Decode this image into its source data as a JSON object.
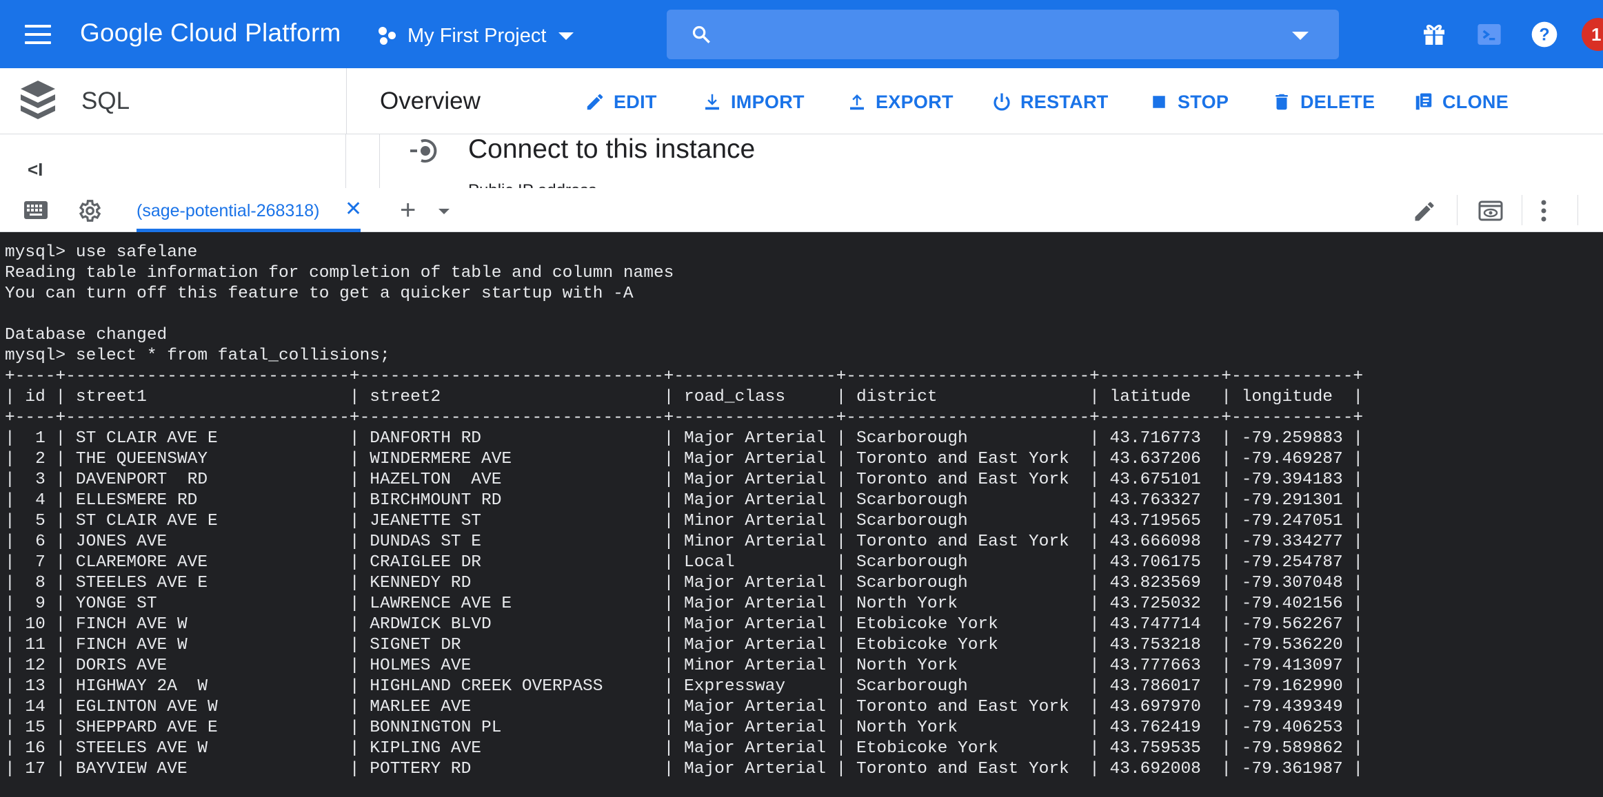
{
  "header": {
    "brand": "Google Cloud Platform",
    "project": "My First Project",
    "search_placeholder": "",
    "notification_count": "1"
  },
  "subbar": {
    "service": "SQL",
    "page_title": "Overview",
    "actions": {
      "edit": "EDIT",
      "import": "IMPORT",
      "export": "EXPORT",
      "restart": "RESTART",
      "stop": "STOP",
      "delete": "DELETE",
      "clone": "CLONE"
    }
  },
  "content": {
    "collapse_label": "<I",
    "connect_title": "Connect to this instance",
    "cut_text": "Public IP address"
  },
  "shell": {
    "tab_label": "(sage-potential-268318)",
    "tab_close": "✕",
    "add_tab": "+"
  },
  "terminal": {
    "lines": [
      "mysql> use safelane",
      "Reading table information for completion of table and column names",
      "You can turn off this feature to get a quicker startup with -A",
      "",
      "Database changed",
      "mysql> select * from fatal_collisions;",
      "+----+----------------------------+------------------------------+----------------+------------------------+------------+------------+",
      "| id | street1                    | street2                      | road_class     | district               | latitude   | longitude  |",
      "+----+----------------------------+------------------------------+----------------+------------------------+------------+------------+",
      "|  1 | ST CLAIR AVE E             | DANFORTH RD                  | Major Arterial | Scarborough            | 43.716773  | -79.259883 |",
      "|  2 | THE QUEENSWAY              | WINDERMERE AVE               | Major Arterial | Toronto and East York  | 43.637206  | -79.469287 |",
      "|  3 | DAVENPORT  RD              | HAZELTON  AVE                | Major Arterial | Toronto and East York  | 43.675101  | -79.394183 |",
      "|  4 | ELLESMERE RD               | BIRCHMOUNT RD                | Major Arterial | Scarborough            | 43.763327  | -79.291301 |",
      "|  5 | ST CLAIR AVE E             | JEANETTE ST                  | Minor Arterial | Scarborough            | 43.719565  | -79.247051 |",
      "|  6 | JONES AVE                  | DUNDAS ST E                  | Minor Arterial | Toronto and East York  | 43.666098  | -79.334277 |",
      "|  7 | CLAREMORE AVE              | CRAIGLEE DR                  | Local          | Scarborough            | 43.706175  | -79.254787 |",
      "|  8 | STEELES AVE E              | KENNEDY RD                   | Major Arterial | Scarborough            | 43.823569  | -79.307048 |",
      "|  9 | YONGE ST                   | LAWRENCE AVE E               | Major Arterial | North York             | 43.725032  | -79.402156 |",
      "| 10 | FINCH AVE W                | ARDWICK BLVD                 | Major Arterial | Etobicoke York         | 43.747714  | -79.562267 |",
      "| 11 | FINCH AVE W                | SIGNET DR                    | Major Arterial | Etobicoke York         | 43.753218  | -79.536220 |",
      "| 12 | DORIS AVE                  | HOLMES AVE                   | Minor Arterial | North York             | 43.777663  | -79.413097 |",
      "| 13 | HIGHWAY 2A  W              | HIGHLAND CREEK OVERPASS      | Expressway     | Scarborough            | 43.786017  | -79.162990 |",
      "| 14 | EGLINTON AVE W             | MARLEE AVE                   | Major Arterial | Toronto and East York  | 43.697970  | -79.439349 |",
      "| 15 | SHEPPARD AVE E             | BONNINGTON PL                | Major Arterial | North York             | 43.762419  | -79.406253 |",
      "| 16 | STEELES AVE W              | KIPLING AVE                  | Major Arterial | Etobicoke York         | 43.759535  | -79.589862 |",
      "| 17 | BAYVIEW AVE                | POTTERY RD                   | Major Arterial | Toronto and East York  | 43.692008  | -79.361987 |"
    ]
  },
  "colors": {
    "appbar": "#1a73e8",
    "accent": "#1a73e8",
    "terminal_bg": "#202124",
    "terminal_fg": "#e8eaed",
    "notif": "#d93025"
  }
}
